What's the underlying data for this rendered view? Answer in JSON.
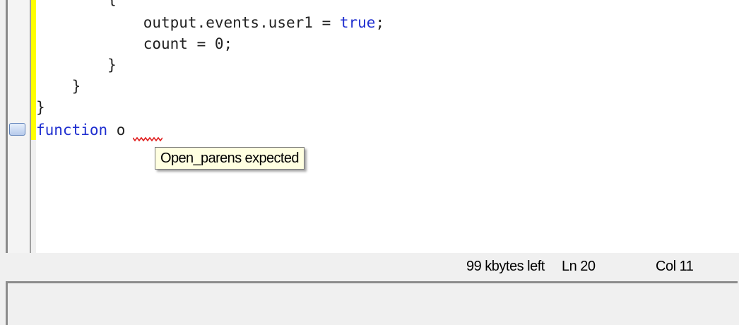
{
  "editor": {
    "lines": [
      {
        "indent": "        ",
        "text": "{"
      },
      {
        "indent": "            ",
        "text": "output.events.user1 = ",
        "keyword": "true",
        "suffix": ";"
      },
      {
        "indent": "            ",
        "text": "count = 0;"
      },
      {
        "indent": "        ",
        "text": "}"
      },
      {
        "indent": "    ",
        "text": "}"
      },
      {
        "indent": "",
        "text": "}"
      }
    ],
    "current_line": {
      "keyword": "function",
      "text": " o"
    }
  },
  "tooltip": {
    "text": "Open_parens expected"
  },
  "status": {
    "memory": "99 kbytes left",
    "line": "Ln 20",
    "column": "Col 11"
  },
  "colors": {
    "keyword": "#1f2fd0",
    "change_bar": "#ffff00",
    "error_squiggle": "#e02020",
    "tooltip_bg": "#ffffe1"
  }
}
